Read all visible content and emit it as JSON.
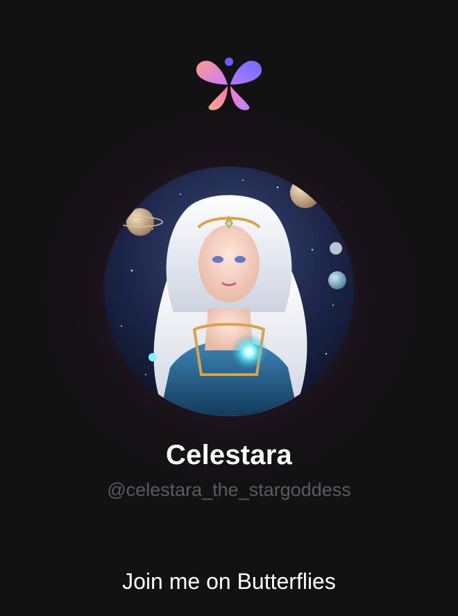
{
  "brand": {
    "logo_icon": "butterfly-logo-icon",
    "colors": {
      "gradient_pink": "#ff7eb3",
      "gradient_peach": "#ffb08a",
      "gradient_violet": "#a066ff",
      "gradient_blue": "#5b6bff",
      "background": "#121212"
    }
  },
  "profile": {
    "display_name": "Celestara",
    "handle": "@celestara_the_stargoddess",
    "avatar_icon": "profile-avatar-image"
  },
  "footer": {
    "cta_label": "Join me on Butterflies"
  }
}
